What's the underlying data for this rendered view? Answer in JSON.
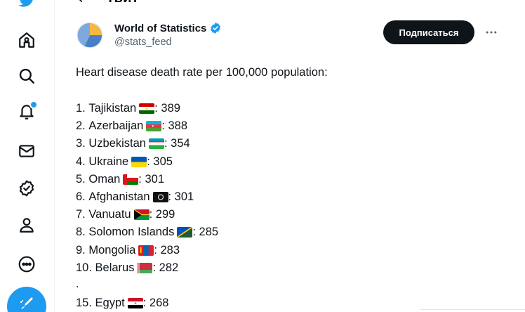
{
  "header": {
    "title": "Твит"
  },
  "nav": {
    "icons": [
      "twitter-icon",
      "home-icon",
      "search-icon",
      "notifications-icon",
      "messages-icon",
      "verified-icon",
      "profile-icon",
      "more-icon",
      "compose-icon"
    ]
  },
  "tweet": {
    "author_name": "World of Statistics",
    "handle": "@stats_feed",
    "follow_label": "Подписаться",
    "headline": "Heart disease death rate per 100,000 population:",
    "entries": [
      {
        "rank": "1.",
        "country": "Tajikistan",
        "flag": "tajikistan-flag-icon",
        "value": ": 389"
      },
      {
        "rank": "2.",
        "country": "Azerbaijan",
        "flag": "azerbaijan-flag-icon",
        "value": ": 388"
      },
      {
        "rank": "3.",
        "country": "Uzbekistan",
        "flag": "uzbekistan-flag-icon",
        "value": ": 354"
      },
      {
        "rank": "4.",
        "country": "Ukraine",
        "flag": "ukraine-flag-icon",
        "value": ": 305"
      },
      {
        "rank": "5.",
        "country": "Oman",
        "flag": "oman-flag-icon",
        "value": ": 301"
      },
      {
        "rank": "6.",
        "country": "Afghanistan",
        "flag": "afghanistan-flag-icon",
        "value": ": 301"
      },
      {
        "rank": "7.",
        "country": "Vanuatu",
        "flag": "vanuatu-flag-icon",
        "value": ": 299"
      },
      {
        "rank": "8.",
        "country": "Solomon Islands",
        "flag": "solomon-islands-flag-icon",
        "value": ": 285"
      },
      {
        "rank": "9.",
        "country": "Mongolia",
        "flag": "mongolia-flag-icon",
        "value": ": 283"
      },
      {
        "rank": "10.",
        "country": "Belarus",
        "flag": "belarus-flag-icon",
        "value": ": 282"
      }
    ],
    "ellipsis": ".",
    "entry15": {
      "rank": "15.",
      "country": "Egypt",
      "flag": "egypt-flag-icon",
      "value": ": 268"
    }
  },
  "colors": {
    "accent": "#1d9bf0",
    "follow_bg": "#0f1419",
    "muted": "#536471"
  }
}
